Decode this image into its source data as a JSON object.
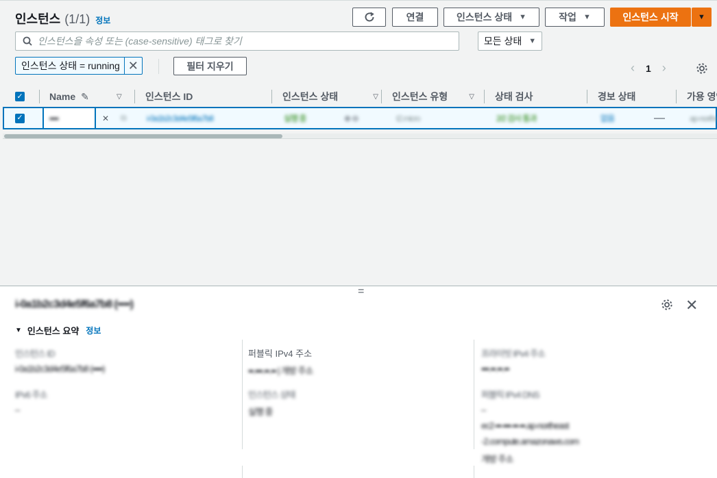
{
  "header": {
    "title": "인스턴스",
    "count": "(1/1)",
    "info": "정보"
  },
  "toolbar": {
    "connect": "연결",
    "instance_state": "인스턴스 상태",
    "actions": "작업",
    "launch": "인스턴스 시작"
  },
  "search": {
    "placeholder": "인스턴스을 속성 또는 (case-sensitive) 태그로 찾기",
    "state_filter": "모든 상태"
  },
  "filter": {
    "token": "인스턴스 상태 = running",
    "clear": "필터 지우기"
  },
  "pagination": {
    "page": "1"
  },
  "table": {
    "columns": [
      "Name",
      "인스턴스 ID",
      "인스턴스 상태",
      "인스턴스 유형",
      "상태 검사",
      "경보 상태",
      "가용 영역"
    ],
    "row": {
      "name": "▪▪▪▪",
      "instance_id": "i-0a1b2c3d4e5f6a7b8",
      "state": "실행 중",
      "type": "t2.micro",
      "status_check": "2/2 검사 통과",
      "alarm": "없음",
      "az_dash": "—",
      "zone": "ap-northeast"
    }
  },
  "details": {
    "title": "i-0a1b2c3d4e5f6a7b8 (▪▪▪▪)",
    "section": "인스턴스 요약",
    "section_info": "정보",
    "col1": {
      "k1": "인스턴스 ID",
      "v1": "i-0a1b2c3d4e5f6a7b8 (▪▪▪▪)",
      "k2": "IPv6 주소",
      "v2": "–"
    },
    "col2": {
      "k1": "퍼블릭 IPv4 주소",
      "v1": "▪▪.▪▪▪.▪▪.▪▪ | 개방 주소",
      "k2": "인스턴스 상태",
      "v2": "실행 중"
    },
    "col3": {
      "k1": "프라이빗 IPv4 주소",
      "v1": "▪▪▪.▪▪.▪▪.▪▪",
      "k2": "퍼블릭 IPv4 DNS",
      "v2": "–",
      "v3": "ec2-▪▪-▪▪▪-▪▪-▪▪.ap-northeast",
      "v4": "-2.compute.amazonaws.com",
      "v5": "개방 주소"
    }
  }
}
